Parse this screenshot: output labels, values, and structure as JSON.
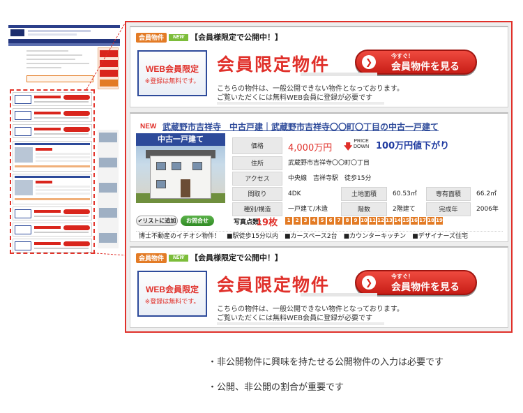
{
  "members_card": {
    "badge": "会員物件",
    "new_tag": "NEW",
    "header": "【会員様限定で公開中！】",
    "box_title": "WEB会員限定",
    "box_sub": "※登録は無料です。",
    "title": "会員限定物件",
    "button_small": "今すぐ！",
    "button_main": "会員物件を見る",
    "button_arrow": "❯",
    "desc_line1": "こちらの物件は、一般公開できない物件となっております。",
    "desc_line2": "ご覧いただくには無料WEB会員に登録が必要です"
  },
  "listing": {
    "new_label": "NEW",
    "title": "武蔵野市吉祥寺　中古戸建｜武蔵野市吉祥寺〇〇町〇丁目の中古一戸建て",
    "photo_label": "中古一戸建て",
    "labels": {
      "price": "価格",
      "address": "住所",
      "access": "アクセス",
      "layout": "間取り",
      "land_area": "土地面積",
      "floor_area": "専有面積",
      "type": "種別/構造",
      "floors": "階数",
      "built": "完成年"
    },
    "values": {
      "price": "4,000万円",
      "price_down_top": "PRICE",
      "price_down_bottom": "DOWN",
      "price_drop": "100万円値下がり",
      "address": "武蔵野市吉祥寺〇〇町〇丁目",
      "access": "中央線　吉祥寺駅　徒歩15分",
      "layout": "4DK",
      "land_area": "60.53㎡",
      "floor_area": "66.2㎡",
      "type": "一戸建て/木造",
      "floors": "2階建て",
      "built": "2006年"
    },
    "list_button": "リストに追加",
    "ask_button": "お問合せ",
    "photo_count_label": "写真点数:",
    "photo_count": "19枚",
    "thumbs": [
      "1",
      "2",
      "3",
      "4",
      "5",
      "6",
      "7",
      "8",
      "9",
      "10",
      "11",
      "12",
      "13",
      "14",
      "15",
      "16",
      "17",
      "18",
      "19"
    ],
    "comment": "博士不動産のイチオシ物件！　■駅徒歩15分以内　■カースペース2台　■カウンターキッチン　■デザイナーズ住宅"
  },
  "notes": {
    "line1": "・非公開物件に興味を持たせる公開物件の入力は必要です",
    "line2": "・公開、非公開の割合が重要です"
  },
  "colors": {
    "accent_red": "#e0302a",
    "brand_blue": "#2d4a9a",
    "badge_orange": "#e37b25",
    "new_green": "#7cbd3a"
  }
}
